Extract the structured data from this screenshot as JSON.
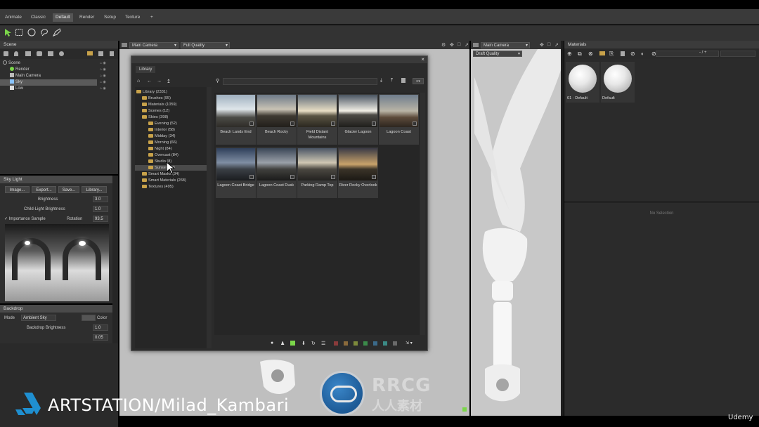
{
  "menubar": {
    "tabs": [
      {
        "label": "Animate",
        "active": false
      },
      {
        "label": "Classic",
        "active": false
      },
      {
        "label": "Default",
        "active": true
      },
      {
        "label": "Render",
        "active": false
      },
      {
        "label": "Setup",
        "active": false
      },
      {
        "label": "Texture",
        "active": false
      },
      {
        "label": "+",
        "active": false
      }
    ]
  },
  "toolbar": {
    "tools": [
      "select-arrow-icon",
      "rect-select-icon",
      "ellipse-select-icon",
      "lasso-select-icon",
      "paint-select-icon"
    ]
  },
  "scene": {
    "title": "Scene",
    "items": [
      {
        "label": "Scene",
        "selected": false
      },
      {
        "label": "Render",
        "selected": false
      },
      {
        "label": "Main Camera",
        "selected": false
      },
      {
        "label": "Sky",
        "selected": true
      },
      {
        "label": "Low",
        "selected": false
      }
    ]
  },
  "skylight": {
    "title": "Sky Light",
    "buttons": [
      "Image...",
      "Export...",
      "Save...",
      "Library..."
    ],
    "brightness_label": "Brightness",
    "brightness_value": "3.0",
    "child_light_label": "Child-Light Brightness",
    "child_light_value": "1.0",
    "importance_label": "Importance Sample",
    "rotation_label": "Rotation",
    "rotation_value": "93.5"
  },
  "backdrop": {
    "title": "Backdrop",
    "mode_label": "Mode",
    "mode_value": "Ambient Sky",
    "color_label": "Color",
    "brightness_label": "Backdrop Brightness",
    "brightness_value": "1.0",
    "extra_value": "0.05"
  },
  "viewport_main": {
    "camera": "Main Camera",
    "quality": "Full Quality"
  },
  "viewport_side": {
    "camera": "Main Camera",
    "quality": "Draft Quality"
  },
  "library": {
    "title": "Library",
    "tree": [
      {
        "label": "Library (2331)",
        "indent": 0
      },
      {
        "label": "Brushes (95)",
        "indent": 1
      },
      {
        "label": "Materials (1059)",
        "indent": 1
      },
      {
        "label": "Scenes (12)",
        "indent": 1
      },
      {
        "label": "Skies (398)",
        "indent": 1
      },
      {
        "label": "Evening (52)",
        "indent": 2
      },
      {
        "label": "Interior (58)",
        "indent": 2
      },
      {
        "label": "Midday (34)",
        "indent": 2
      },
      {
        "label": "Morning (66)",
        "indent": 2
      },
      {
        "label": "Night (84)",
        "indent": 2
      },
      {
        "label": "Overcast (84)",
        "indent": 2
      },
      {
        "label": "Studio (8)",
        "indent": 2
      },
      {
        "label": "Sunset (48)",
        "indent": 2,
        "selected": true
      },
      {
        "label": "Smart Masks (34)",
        "indent": 1
      },
      {
        "label": "Smart Materials (268)",
        "indent": 1
      },
      {
        "label": "Textures (495)",
        "indent": 1
      }
    ],
    "thumbs": [
      {
        "label": "Beach Lands End"
      },
      {
        "label": "Beach Rocky"
      },
      {
        "label": "Field Distant Mountains"
      },
      {
        "label": "Glacier Lagoon"
      },
      {
        "label": "Lagoon Coast"
      },
      {
        "label": "Lagoon Coast Bridge"
      },
      {
        "label": "Lagoon Coast Dusk"
      },
      {
        "label": "Parking Ramp Top"
      },
      {
        "label": "River Rocky Overlook"
      }
    ]
  },
  "materials": {
    "title": "Materials",
    "counter": "- / +",
    "items": [
      {
        "label": "01 - Default"
      },
      {
        "label": "Default"
      }
    ],
    "no_selection": "No Selection"
  },
  "watermarks": {
    "artstation": "ARTSTATION/Milad_Kambari",
    "rrcg": "RRCG",
    "rrcg_cn": "人人素材",
    "udemy": "Udemy"
  }
}
